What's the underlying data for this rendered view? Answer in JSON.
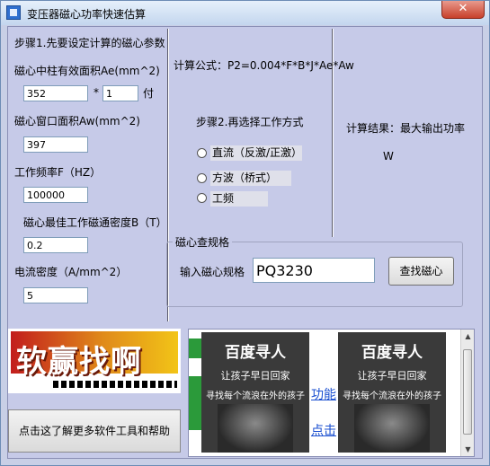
{
  "window": {
    "title": "变压器磁心功率快速估算",
    "close_label": "✕"
  },
  "step1": {
    "heading": "步骤1.先要设定计算的磁心参数",
    "ae_label": "磁心中柱有效面积Ae(mm^2)",
    "ae_value": "352",
    "multiply_label": "*",
    "count_value": "1",
    "count_unit": "付",
    "aw_label": "磁心窗口面积Aw(mm^2)",
    "aw_value": "397",
    "freq_label": "工作频率F（HZ）",
    "freq_value": "100000",
    "flux_label": "磁心最佳工作磁通密度B（T）",
    "flux_value": "0.2",
    "current_label": "电流密度（A/mm^2）",
    "current_value": "5"
  },
  "formula": {
    "text": "计算公式：P2=0.004*F*B*J*Ae*Aw"
  },
  "step2": {
    "heading": "步骤2.再选择工作方式",
    "options": [
      "直流（反激/正激）",
      "方波（桥式）",
      "工频"
    ]
  },
  "result": {
    "label": "计算结果：最大输出功率",
    "unit": "W"
  },
  "lookup": {
    "legend": "磁心查规格",
    "input_label": "输入磁心规格",
    "input_value": "PQ3230",
    "button_label": "查找磁心"
  },
  "bottom": {
    "logo_text": "软赢找啊",
    "help_button": "点击这了解更多软件工具和帮助",
    "ad_cards": [
      {
        "title": "百度寻人",
        "line1": "让孩子早日回家",
        "line2": "寻找每个流浪在外的孩子"
      },
      {
        "title": "百度寻人",
        "line1": "让孩子早日回家",
        "line2": "寻找每个流浪在外的孩子"
      }
    ],
    "ad_link1": "功能",
    "ad_link2": "点击"
  },
  "colors": {
    "panel_bg": "#c6cae8",
    "title_bg": "#c3d6ee",
    "close_red": "#c7402b",
    "link_blue": "#1a4fd0"
  }
}
